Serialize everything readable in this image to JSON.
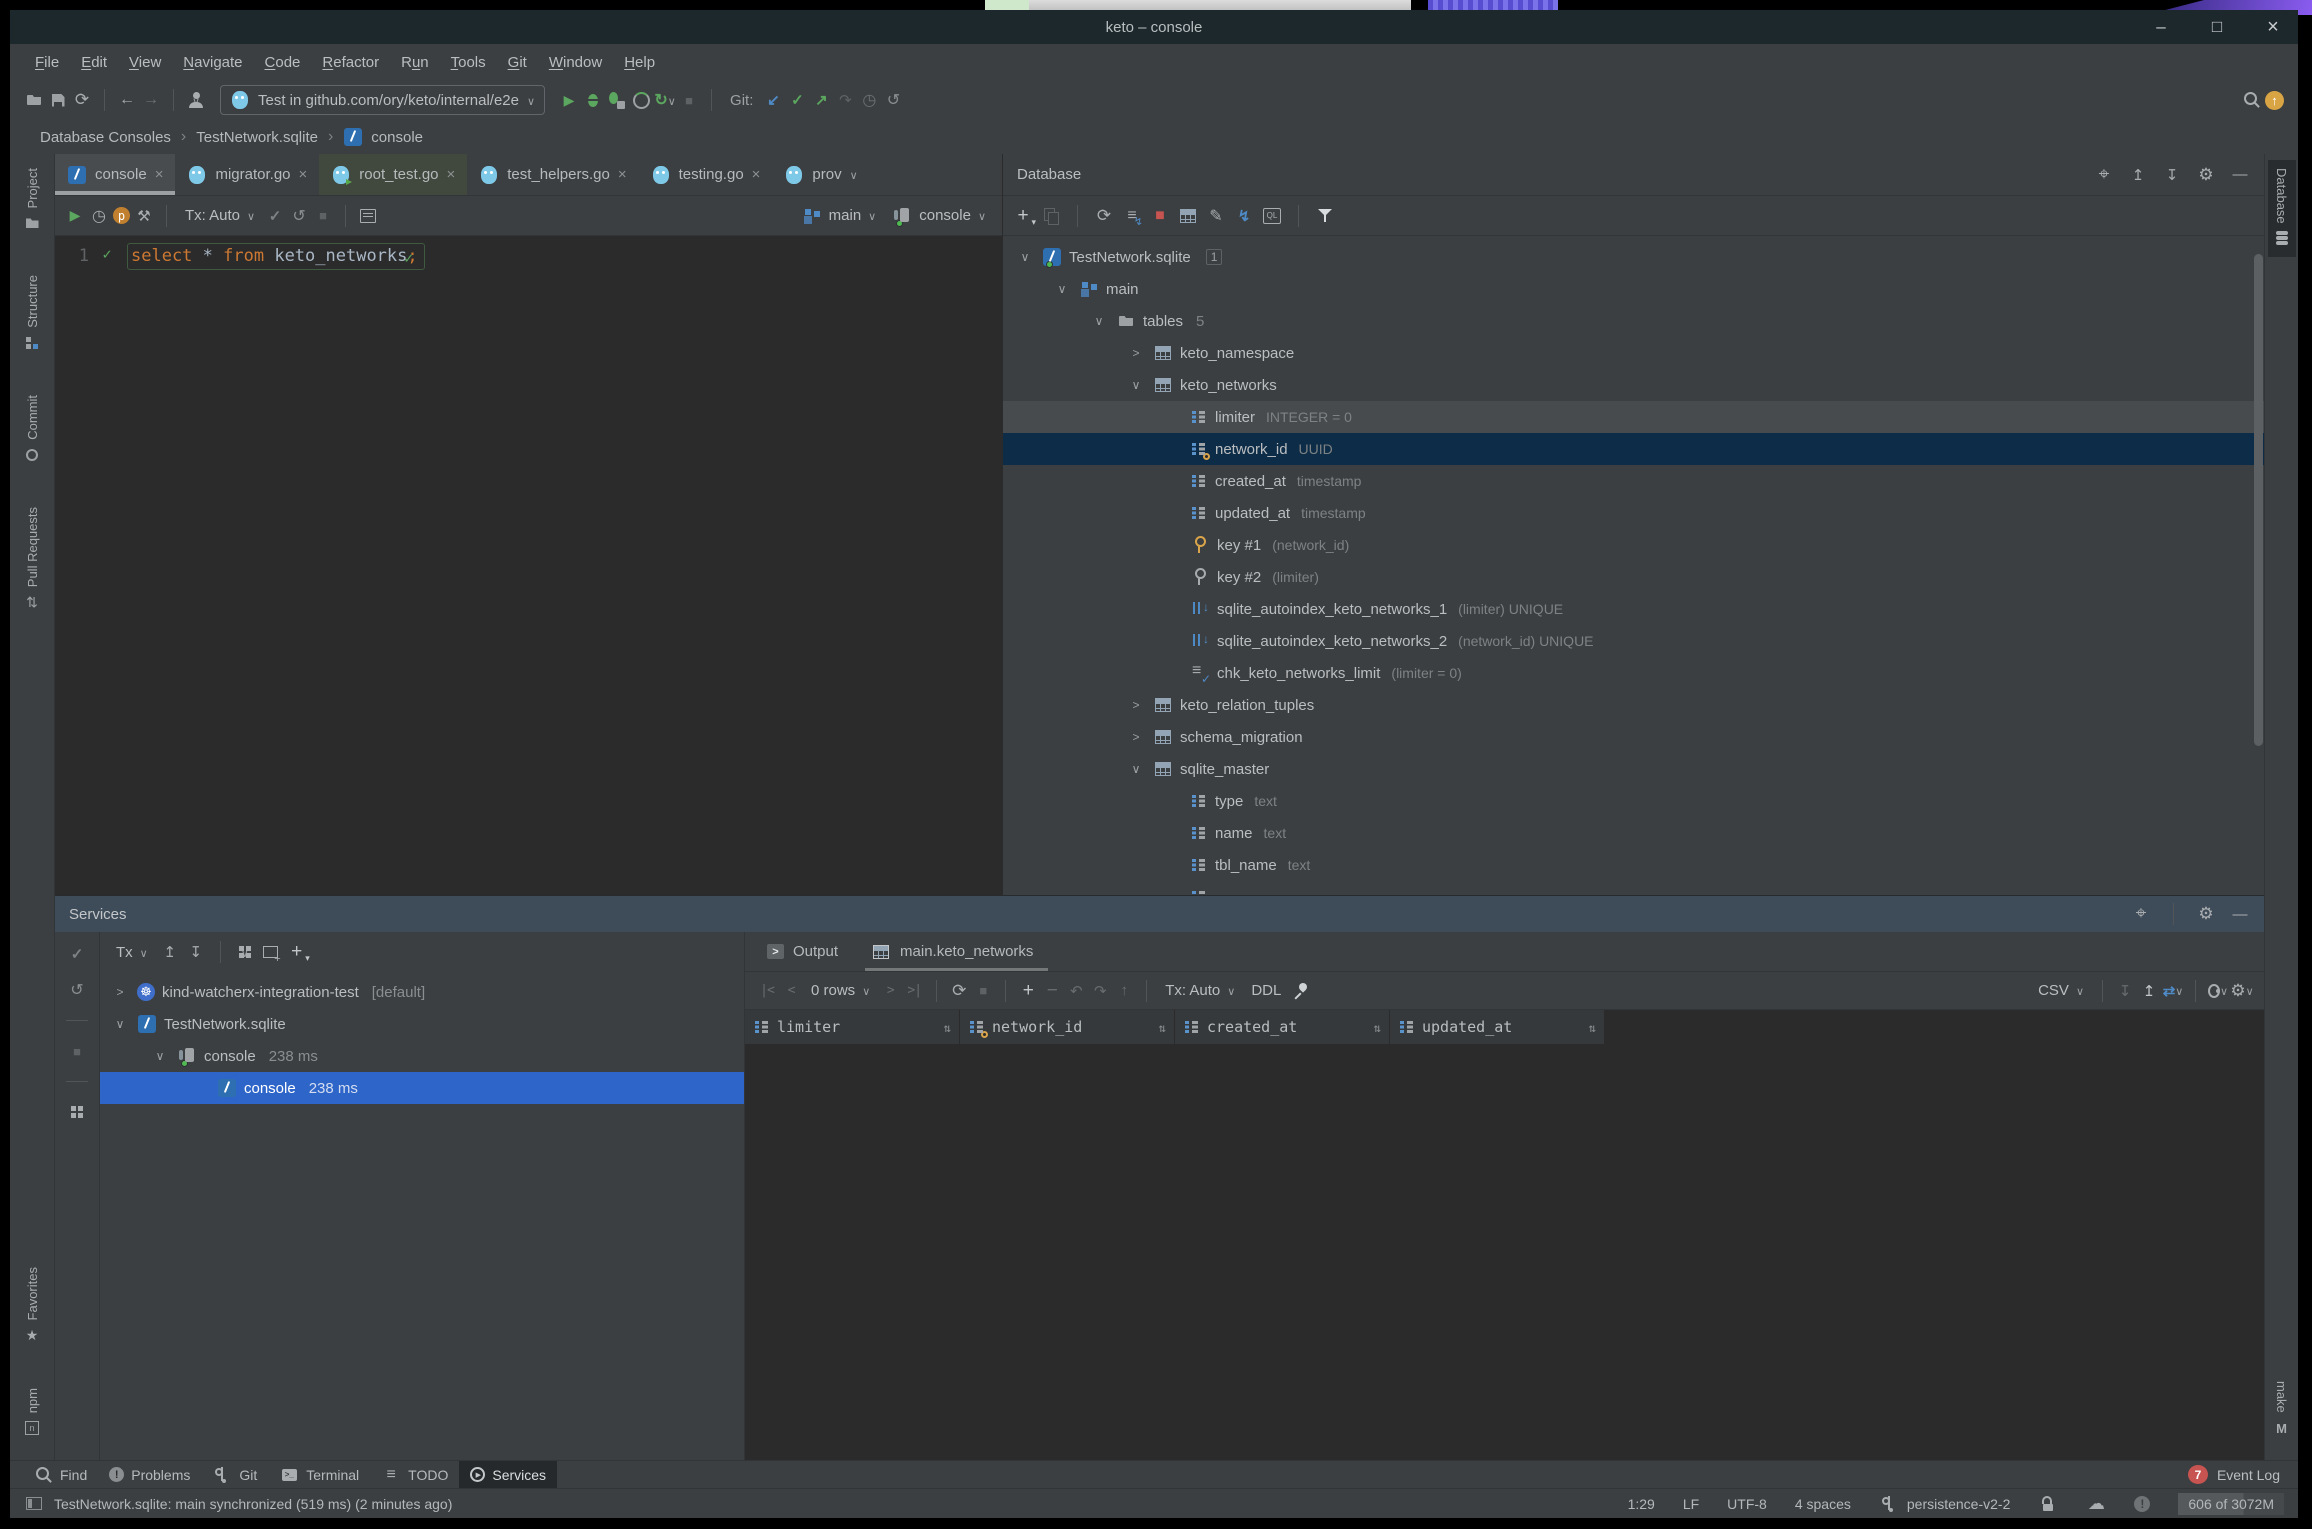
{
  "window": {
    "title": "keto – console",
    "controls": [
      "minimize",
      "maximize",
      "close"
    ]
  },
  "menu": {
    "items": [
      {
        "label": "File",
        "mn": 0
      },
      {
        "label": "Edit",
        "mn": 0
      },
      {
        "label": "View",
        "mn": 0
      },
      {
        "label": "Navigate",
        "mn": 0
      },
      {
        "label": "Code",
        "mn": 0
      },
      {
        "label": "Refactor",
        "mn": 0
      },
      {
        "label": "Run",
        "mn": 1
      },
      {
        "label": "Tools",
        "mn": 0
      },
      {
        "label": "Git",
        "mn": 0
      },
      {
        "label": "Window",
        "mn": 0
      },
      {
        "label": "Help",
        "mn": 0
      }
    ]
  },
  "main_toolbar": {
    "items": [
      {
        "icon": "open-folder",
        "name": "open-button"
      },
      {
        "icon": "save",
        "name": "save-all-button"
      },
      {
        "icon": "sync",
        "name": "sync-button"
      },
      {
        "sep": true
      },
      {
        "icon": "back",
        "name": "back-button"
      },
      {
        "icon": "forward",
        "cls": "dim",
        "name": "forward-button"
      },
      {
        "sep": true
      },
      {
        "icon": "user",
        "chev": true,
        "name": "profile-button"
      },
      {
        "combo": true,
        "icon": "go",
        "label": "Test in github.com/ory/keto/internal/e2e",
        "chev": true,
        "name": "run-configuration-combo"
      },
      {
        "icon": "run",
        "name": "run-button"
      },
      {
        "icon": "debug",
        "name": "debug-button"
      },
      {
        "icon": "coverage",
        "name": "run-with-coverage-button"
      },
      {
        "icon": "profiler",
        "name": "profiler-button"
      },
      {
        "icon": "rerun",
        "chev": true,
        "name": "run-with-profiler-button"
      },
      {
        "icon": "stop",
        "cls": "dim",
        "name": "stop-button"
      },
      {
        "sep": true
      },
      {
        "label": "Git:",
        "cls": "plain",
        "click": false,
        "name": "git-label"
      },
      {
        "icon": "git-update",
        "name": "git-update-button"
      },
      {
        "icon": "git-commit",
        "name": "git-commit-button"
      },
      {
        "icon": "git-push",
        "name": "git-push-button"
      },
      {
        "icon": "git-cherrypick",
        "cls": "dim",
        "name": "git-cherry-pick-button"
      },
      {
        "icon": "history",
        "cls": "dim",
        "name": "git-history-button"
      },
      {
        "icon": "rollback",
        "name": "git-rollback-button"
      },
      {
        "spacer": true
      },
      {
        "icon": "search",
        "name": "search-everywhere-button"
      },
      {
        "icon": "update-badge",
        "name": "ide-update-button"
      }
    ]
  },
  "breadcrumbs": {
    "items": [
      {
        "label": "Database Consoles"
      },
      {
        "label": "TestNetwork.sqlite"
      },
      {
        "label": "console",
        "icon": "sqlite-file"
      }
    ]
  },
  "editor_tabs": [
    {
      "label": "console",
      "icon": "sqlite-file",
      "active": true,
      "close": true
    },
    {
      "label": "migrator.go",
      "icon": "go",
      "close": true
    },
    {
      "label": "root_test.go",
      "icon": "go-test",
      "tinted": true,
      "close": true
    },
    {
      "label": "test_helpers.go",
      "icon": "go",
      "close": true
    },
    {
      "label": "testing.go",
      "icon": "go",
      "close": true
    },
    {
      "label": "prov",
      "icon": "go",
      "dropdown": true
    }
  ],
  "console_toolbar": {
    "items": [
      {
        "icon": "run",
        "name": "execute-button"
      },
      {
        "icon": "history",
        "name": "query-history-button"
      },
      {
        "icon": "params",
        "name": "parameters-button"
      },
      {
        "icon": "wrench",
        "name": "settings-button"
      },
      {
        "sep": true
      },
      {
        "label": "Tx: Auto",
        "chev": true,
        "name": "tx-mode-select"
      },
      {
        "icon": "commit-check",
        "name": "commit-button"
      },
      {
        "icon": "rollback",
        "name": "rollback-button"
      },
      {
        "icon": "stop",
        "cls": "dim",
        "name": "cancel-query-button"
      },
      {
        "sep": true
      },
      {
        "icon": "output-lines",
        "name": "output-console-button"
      },
      {
        "spacer": true
      },
      {
        "icon": "schema",
        "label": "main",
        "chev": true,
        "name": "schema-select"
      },
      {
        "icon": "session",
        "label": "console",
        "chev": true,
        "dot": true,
        "name": "session-select"
      }
    ]
  },
  "editor": {
    "line_number": "1",
    "sql": [
      {
        "text": "select",
        "style": "kw"
      },
      {
        "text": " * ",
        "style": "pln"
      },
      {
        "text": "from",
        "style": "kw"
      },
      {
        "text": " keto_networks",
        "style": "pln"
      },
      {
        "text": ";",
        "style": "kw"
      }
    ]
  },
  "database_panel": {
    "title": "Database",
    "header_icons": [
      {
        "icon": "locate",
        "name": "select-opened-file-button"
      },
      {
        "icon": "expand-all",
        "name": "expand-all-button"
      },
      {
        "icon": "collapse-all",
        "name": "collapse-all-button"
      },
      {
        "icon": "gear",
        "name": "database-settings-button"
      },
      {
        "icon": "min",
        "name": "hide-panel-button"
      }
    ],
    "toolbar": [
      {
        "icon": "plus-chev",
        "name": "add-data-source-button"
      },
      {
        "icon": "copy",
        "cls": "dim",
        "name": "duplicate-button"
      },
      {
        "sep": true
      },
      {
        "icon": "refresh",
        "name": "refresh-button"
      },
      {
        "icon": "sync-schemas",
        "name": "sync-schemas-button"
      },
      {
        "icon": "stop-red",
        "name": "cancel-running-statements-button"
      },
      {
        "icon": "table-new",
        "name": "new-table-button"
      },
      {
        "icon": "pencil",
        "name": "modify-button"
      },
      {
        "icon": "jump",
        "name": "jump-to-console-button"
      },
      {
        "icon": "ql",
        "name": "query-console-button"
      },
      {
        "sep": true
      },
      {
        "icon": "filter",
        "name": "filter-button"
      }
    ],
    "tree": [
      {
        "label": "TestNetwork.sqlite",
        "icon": "sqlite-db",
        "dot": true,
        "chev": "open",
        "indent": 0,
        "badge": "1"
      },
      {
        "label": "main",
        "icon": "schema",
        "chev": "open",
        "indent": 1
      },
      {
        "label": "tables",
        "icon": "tables-folder",
        "chev": "open",
        "indent": 2,
        "count": "5"
      },
      {
        "label": "keto_namespace",
        "icon": "table",
        "chev": "closed",
        "indent": 3
      },
      {
        "label": "keto_networks",
        "icon": "table",
        "chev": "open",
        "indent": 3
      },
      {
        "label": "limiter",
        "icon": "column",
        "ann": "INTEGER = 0",
        "indent": 4,
        "hover": true
      },
      {
        "label": "network_id",
        "icon": "column",
        "key": true,
        "ann": "UUID",
        "indent": 4,
        "selected": true
      },
      {
        "label": "created_at",
        "icon": "column",
        "ann": "timestamp",
        "indent": 4
      },
      {
        "label": "updated_at",
        "icon": "column",
        "ann": "timestamp",
        "indent": 4
      },
      {
        "label": "key #1",
        "icon": "key",
        "ann": "(network_id)",
        "indent": 4
      },
      {
        "label": "key #2",
        "icon": "key-hollow",
        "ann": "(limiter)",
        "indent": 4
      },
      {
        "label": "sqlite_autoindex_keto_networks_1",
        "icon": "index",
        "ann": "(limiter) UNIQUE",
        "indent": 4
      },
      {
        "label": "sqlite_autoindex_keto_networks_2",
        "icon": "index",
        "ann": "(network_id) UNIQUE",
        "indent": 4
      },
      {
        "label": "chk_keto_networks_limit",
        "icon": "constraint",
        "ann": "(limiter = 0)",
        "indent": 4
      },
      {
        "label": "keto_relation_tuples",
        "icon": "table",
        "chev": "closed",
        "indent": 3
      },
      {
        "label": "schema_migration",
        "icon": "table",
        "chev": "closed",
        "indent": 3
      },
      {
        "label": "sqlite_master",
        "icon": "table",
        "chev": "open",
        "indent": 3
      },
      {
        "label": "type",
        "icon": "column",
        "ann": "text",
        "indent": 4
      },
      {
        "label": "name",
        "icon": "column",
        "ann": "text",
        "indent": 4
      },
      {
        "label": "tbl_name",
        "icon": "column",
        "ann": "text",
        "indent": 4
      },
      {
        "label": "",
        "icon": "column",
        "ann": "",
        "indent": 4
      }
    ]
  },
  "left_stripe": {
    "top": [
      {
        "icon": "project",
        "label": "Project"
      },
      {
        "icon": "structure",
        "label": "Structure"
      },
      {
        "icon": "commit",
        "label": "Commit"
      },
      {
        "icon": "pr",
        "label": "Pull Requests"
      }
    ],
    "bottom": [
      {
        "icon": "favorites",
        "label": "Favorites"
      },
      {
        "icon": "npm",
        "label": "npm"
      }
    ]
  },
  "right_stripe": {
    "top": [
      {
        "icon": "db-disks",
        "label": "Database",
        "active": true
      }
    ],
    "bottom": [
      {
        "icon": "make",
        "label": "make"
      }
    ]
  },
  "services": {
    "title": "Services",
    "header_icons": [
      {
        "icon": "locate",
        "name": "select-in-tree-button"
      },
      {
        "sep": true
      },
      {
        "icon": "gear",
        "name": "services-settings-button"
      },
      {
        "icon": "min",
        "name": "hide-services-button"
      }
    ],
    "toolbar": [
      {
        "label": "Tx",
        "chev": true,
        "name": "tx-filter"
      },
      {
        "icon": "expand-all",
        "name": "expand-all-button"
      },
      {
        "icon": "collapse-all",
        "name": "collapse-all-button"
      },
      {
        "sep": true
      },
      {
        "icon": "grid4",
        "chev": true,
        "name": "group-by-button"
      },
      {
        "icon": "float",
        "name": "open-in-new-tab-button"
      },
      {
        "icon": "plus-chev",
        "name": "add-service-button"
      }
    ],
    "side_toolbar": [
      {
        "icon": "commit-check",
        "name": "commit-button"
      },
      {
        "icon": "rollback",
        "name": "rollback-button"
      },
      {
        "hr": true
      },
      {
        "icon": "stop",
        "cls": "dim",
        "name": "stop-process-button"
      },
      {
        "hr": true
      },
      {
        "icon": "grid4",
        "name": "show-configurations-button"
      }
    ],
    "tree": [
      {
        "label": "kind-watcherx-integration-test",
        "suffix": "[default]",
        "icon": "k8s",
        "chev": "closed",
        "indent": 0
      },
      {
        "label": "TestNetwork.sqlite",
        "icon": "sqlite-db",
        "chev": "open",
        "indent": 0
      },
      {
        "label": "console",
        "suffix": "238 ms",
        "icon": "session",
        "dot": true,
        "chev": "open",
        "indent": 1
      },
      {
        "label": "console",
        "suffix": "238 ms",
        "icon": "sqlite-file",
        "indent": 2,
        "selected": true
      }
    ],
    "output_tabs": [
      {
        "label": "Output",
        "icon": "run-box",
        "close": true
      },
      {
        "label": "main.keto_networks",
        "icon": "table-light",
        "close": true,
        "active": true
      }
    ],
    "grid_toolbar": [
      {
        "icon": "nav-first",
        "cls": "dim",
        "name": "first-page-button"
      },
      {
        "icon": "nav-prev",
        "cls": "dim",
        "name": "previous-page-button"
      },
      {
        "label": "0 rows",
        "chev": true,
        "name": "page-size-select"
      },
      {
        "icon": "nav-next",
        "cls": "dim",
        "name": "next-page-button"
      },
      {
        "icon": "nav-last",
        "cls": "dim",
        "name": "last-page-button"
      },
      {
        "sep": true
      },
      {
        "icon": "refresh",
        "name": "reload-data-button"
      },
      {
        "icon": "stop",
        "cls": "dim",
        "name": "stop-query-button"
      },
      {
        "sep": true
      },
      {
        "icon": "plus",
        "name": "add-row-button"
      },
      {
        "icon": "minus",
        "cls": "dim",
        "name": "delete-row-button"
      },
      {
        "icon": "undo",
        "cls": "dim",
        "name": "revert-button"
      },
      {
        "icon": "redo",
        "cls": "dim",
        "name": "find-button"
      },
      {
        "icon": "up-arrow",
        "cls": "dim",
        "name": "submit-button"
      },
      {
        "sep": true
      },
      {
        "label": "Tx: Auto",
        "chev": true,
        "name": "grid-tx-mode-select"
      },
      {
        "label": "DDL",
        "name": "ddl-button"
      },
      {
        "icon": "pin",
        "name": "pin-tab-button"
      }
    ],
    "grid_toolbar_right": [
      {
        "label": "CSV",
        "chev": true,
        "name": "export-format-select"
      },
      {
        "sep": true
      },
      {
        "icon": "download",
        "cls": "dim",
        "name": "export-data-button"
      },
      {
        "icon": "upload",
        "name": "import-data-button"
      },
      {
        "icon": "compare",
        "chev": true,
        "name": "compare-button"
      },
      {
        "sep": true
      },
      {
        "icon": "eye",
        "chev": true,
        "name": "view-options-button"
      },
      {
        "icon": "gear",
        "chev": true,
        "name": "grid-settings-button"
      }
    ],
    "grid_columns": [
      {
        "label": "limiter",
        "icon": "column"
      },
      {
        "label": "network_id",
        "icon": "column",
        "key": true
      },
      {
        "label": "created_at",
        "icon": "column"
      },
      {
        "label": "updated_at",
        "icon": "column"
      }
    ]
  },
  "bottom_bar": {
    "items": [
      {
        "icon": "search",
        "label": "Find"
      },
      {
        "icon": "error",
        "label": "Problems"
      },
      {
        "icon": "branch",
        "label": "Git"
      },
      {
        "icon": "terminal",
        "label": "Terminal"
      },
      {
        "icon": "todo",
        "label": "TODO"
      },
      {
        "icon": "services",
        "label": "Services",
        "active": true
      }
    ],
    "event_log": {
      "badge": "7",
      "label": "Event Log"
    }
  },
  "status_bar": {
    "message": "TestNetwork.sqlite: main synchronized (519 ms) (2 minutes ago)",
    "right": [
      {
        "label": "1:29",
        "name": "caret-position"
      },
      {
        "label": "LF",
        "name": "line-separator"
      },
      {
        "label": "UTF-8",
        "name": "file-encoding"
      },
      {
        "label": "4 spaces",
        "name": "indent-size"
      },
      {
        "icon": "branch",
        "label": "persistence-v2-2",
        "name": "git-branch-widget"
      },
      {
        "icon": "lock",
        "name": "readonly-toggle"
      },
      {
        "icon": "cloud",
        "name": "cloud-sync-widget"
      },
      {
        "icon": "warn",
        "name": "inspections-widget"
      },
      {
        "label": "606 of 3072M",
        "cls": "memory",
        "name": "memory-indicator"
      }
    ]
  },
  "colors": {
    "chrome": "#3c3f41",
    "editor_bg": "#2b2b2b",
    "selection_active": "#2e65c9",
    "selection_inactive": "#0d2c47",
    "services_header": "#3e4b59",
    "keyword": "#cc7832",
    "plain_code": "#a9b7c6",
    "accent_blue": "#4e8ac6",
    "green": "#5ca75f",
    "red_badge": "#c75450"
  }
}
